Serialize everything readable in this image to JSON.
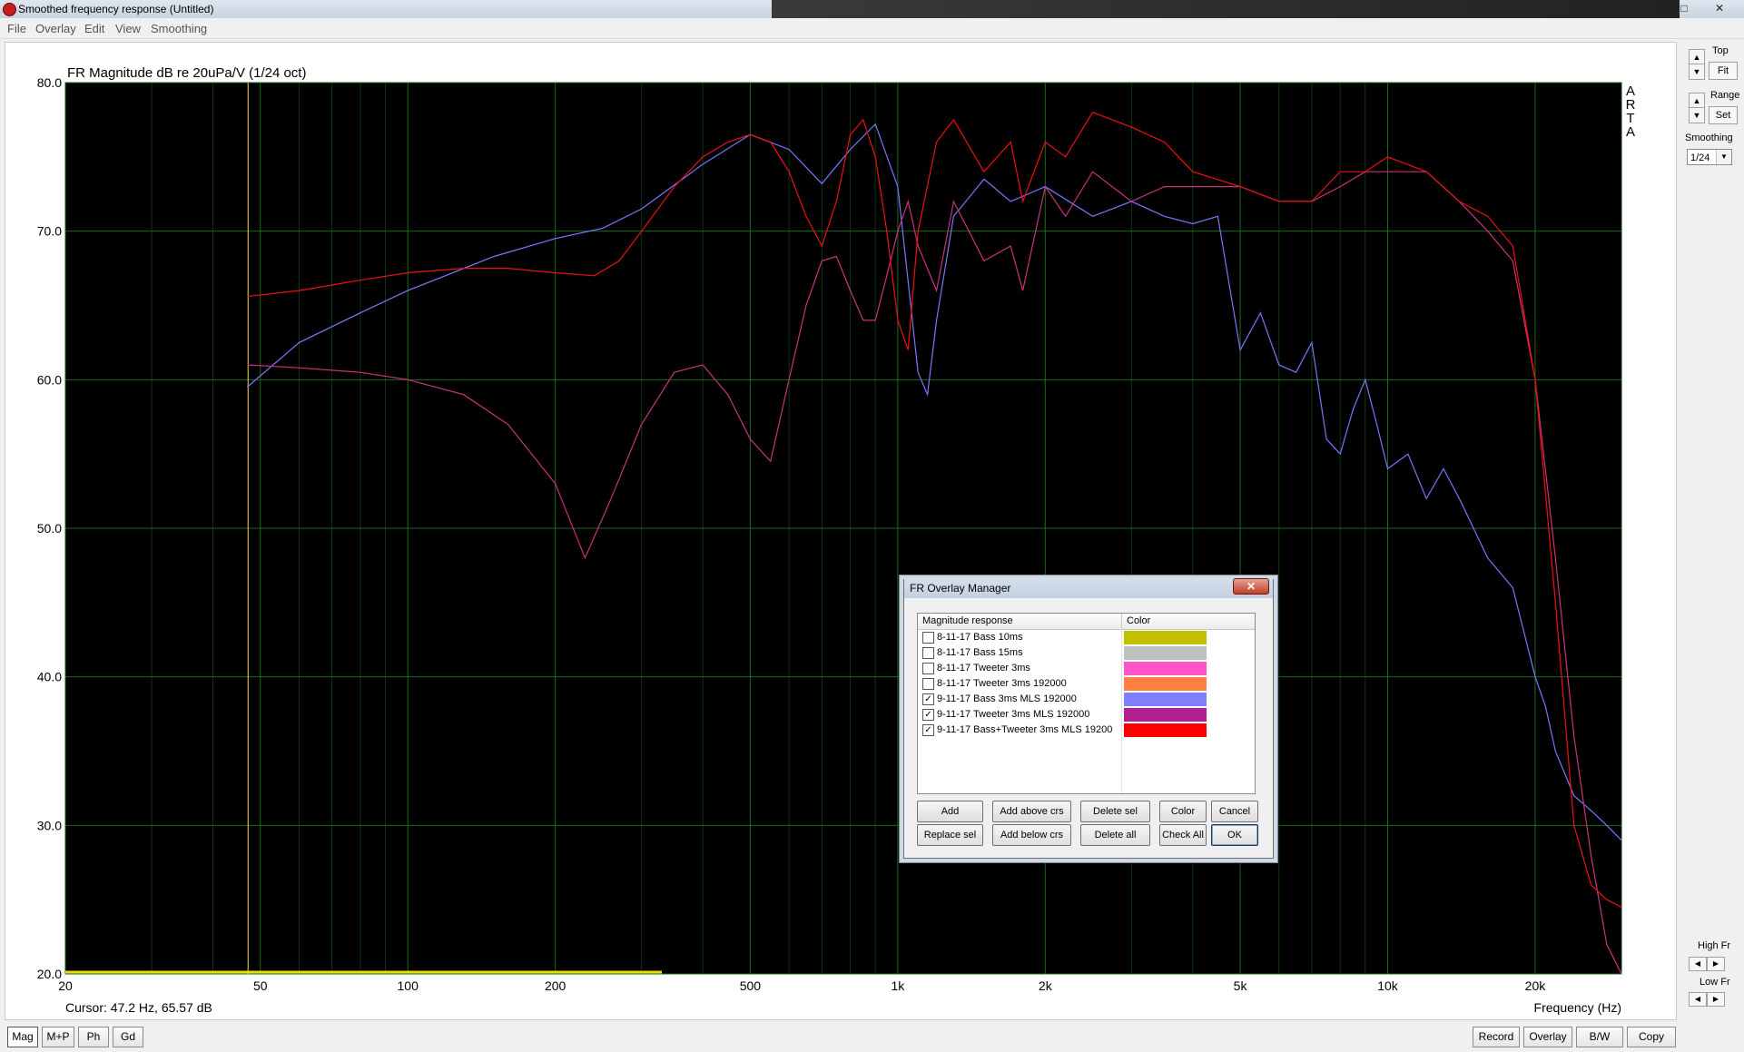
{
  "window": {
    "title": "Smoothed frequency response (Untitled)",
    "controls": {
      "minimize": "–",
      "maximize": "□",
      "close": "✕"
    }
  },
  "menu": [
    "File",
    "Overlay",
    "Edit",
    "View",
    "Smoothing"
  ],
  "sidebar": {
    "top_label": "Top",
    "fit_label": "Fit",
    "range_label": "Range",
    "set_label": "Set",
    "smoothing_label": "Smoothing",
    "smoothing_value": "1/24",
    "high_fr_label": "High Fr",
    "low_fr_label": "Low Fr"
  },
  "bottombar": {
    "left_buttons": [
      "Mag",
      "M+P",
      "Ph",
      "Gd"
    ],
    "active": "Mag",
    "right_buttons": [
      "Record",
      "Overlay",
      "B/W",
      "Copy"
    ]
  },
  "chart_data": {
    "type": "line",
    "title": "FR Magnitude dB re 20uPa/V (1/24 oct)",
    "xlabel": "Frequency (Hz)",
    "ylabel": "",
    "xscale": "log",
    "xlim": [
      20,
      30000
    ],
    "ylim": [
      20,
      80
    ],
    "xticks": [
      20,
      50,
      100,
      200,
      500,
      1000,
      2000,
      5000,
      10000,
      20000
    ],
    "xticklabels": [
      "20",
      "50",
      "100",
      "200",
      "500",
      "1k",
      "2k",
      "5k",
      "10k",
      "20k"
    ],
    "yticks": [
      20,
      30,
      40,
      50,
      60,
      70,
      80
    ],
    "yticklabels": [
      "20.0",
      "30.0",
      "40.0",
      "50.0",
      "60.0",
      "70.0",
      "80.0"
    ],
    "grid": true,
    "background": "#000000",
    "watermark": "ARTA",
    "cursor": {
      "freq_hz": 47.2,
      "db": 65.57
    },
    "cursor_text": "Cursor: 47.2 Hz, 65.57 dB",
    "series": [
      {
        "name": "9-11-17 Bass 3ms MLS 192000",
        "color": "#7777ff",
        "x": [
          47,
          60,
          80,
          100,
          150,
          200,
          250,
          300,
          400,
          500,
          600,
          700,
          800,
          900,
          1000,
          1100,
          1150,
          1200,
          1300,
          1500,
          1700,
          2000,
          2500,
          3000,
          3500,
          4000,
          4500,
          5000,
          5500,
          6000,
          6500,
          7000,
          7500,
          8000,
          8500,
          9000,
          9500,
          10000,
          11000,
          12000,
          13000,
          14000,
          16000,
          18000,
          20000,
          21000,
          22000,
          24000,
          26000,
          28000,
          30000
        ],
        "y": [
          59.5,
          62.5,
          64.5,
          66,
          68.3,
          69.5,
          70.2,
          71.5,
          74.5,
          76.5,
          75.5,
          73.2,
          75.5,
          77.2,
          73,
          60.5,
          59,
          64,
          71,
          73.5,
          72,
          73,
          71,
          72,
          71,
          70.5,
          71,
          62,
          64.5,
          61,
          60.5,
          62.5,
          56,
          55,
          58,
          60,
          57,
          54,
          55,
          52,
          54,
          52,
          48,
          46,
          40,
          38,
          35,
          32,
          31,
          30,
          29
        ]
      },
      {
        "name": "9-11-17 Tweeter 3ms MLS 192000",
        "color": "#cc3377",
        "x": [
          47,
          60,
          80,
          100,
          130,
          160,
          200,
          230,
          260,
          300,
          350,
          400,
          450,
          500,
          550,
          600,
          650,
          700,
          750,
          800,
          850,
          900,
          950,
          1000,
          1050,
          1100,
          1200,
          1300,
          1500,
          1700,
          1800,
          2000,
          2200,
          2500,
          3000,
          3500,
          4000,
          5000,
          6000,
          7000,
          8000,
          9000,
          10000,
          12000,
          14000,
          16000,
          18000,
          20000,
          22000,
          24000,
          26000,
          28000,
          30000
        ],
        "y": [
          61,
          60.8,
          60.5,
          60,
          59,
          57,
          53,
          48,
          52,
          57,
          60.5,
          61,
          59,
          56,
          54.5,
          60,
          65,
          68,
          68.3,
          66,
          64,
          64,
          67,
          70,
          72,
          69,
          66,
          72,
          68,
          69,
          66,
          73,
          71,
          74,
          72,
          73,
          73,
          73,
          72,
          72,
          73,
          74,
          74,
          74,
          72,
          70,
          68,
          60,
          48,
          36,
          28,
          22,
          20
        ]
      },
      {
        "name": "9-11-17 Bass+Tweeter 3ms MLS 19200",
        "color": "#ee1111",
        "x": [
          47,
          60,
          80,
          100,
          130,
          160,
          200,
          240,
          270,
          300,
          350,
          400,
          450,
          500,
          550,
          600,
          650,
          700,
          750,
          800,
          850,
          900,
          950,
          1000,
          1050,
          1100,
          1200,
          1300,
          1500,
          1700,
          1800,
          2000,
          2200,
          2500,
          3000,
          3500,
          4000,
          5000,
          6000,
          7000,
          8000,
          9000,
          10000,
          12000,
          14000,
          16000,
          18000,
          20000,
          22000,
          24000,
          26000,
          28000,
          30000
        ],
        "y": [
          65.6,
          66,
          66.7,
          67.2,
          67.5,
          67.5,
          67.2,
          67,
          68,
          70,
          73,
          75,
          76,
          76.5,
          76,
          74,
          71,
          69,
          72,
          76.5,
          77.5,
          75,
          70,
          64,
          62,
          70,
          76,
          77.5,
          74,
          76,
          72,
          76,
          75,
          78,
          77,
          76,
          74,
          73,
          72,
          72,
          74,
          74,
          75,
          74,
          72,
          71,
          69,
          60,
          45,
          30,
          26,
          25,
          24.5
        ]
      }
    ]
  },
  "dialog": {
    "title": "FR Overlay Manager",
    "close_label": "✕",
    "col_name": "Magnitude response",
    "col_color": "Color",
    "rows": [
      {
        "name": "8-11-17 Bass 10ms",
        "checked": false,
        "color": "#c0c000"
      },
      {
        "name": "8-11-17 Bass 15ms",
        "checked": false,
        "color": "#c0c0c0"
      },
      {
        "name": "8-11-17 Tweeter 3ms",
        "checked": false,
        "color": "#ff55c8"
      },
      {
        "name": "8-11-17 Tweeter 3ms 192000",
        "checked": false,
        "color": "#ff8040"
      },
      {
        "name": "9-11-17 Bass 3ms MLS 192000",
        "checked": true,
        "color": "#8080ff"
      },
      {
        "name": "9-11-17 Tweeter 3ms MLS 192000",
        "checked": true,
        "color": "#b02090"
      },
      {
        "name": "9-11-17 Bass+Tweeter 3ms MLS 19200",
        "checked": true,
        "color": "#ff0000"
      }
    ],
    "buttons_row1": [
      "Add",
      "Add above crs",
      "Delete sel",
      "Color",
      "Cancel"
    ],
    "buttons_row2": [
      "Replace sel",
      "Add below crs",
      "Delete all",
      "Check All",
      "OK"
    ]
  }
}
